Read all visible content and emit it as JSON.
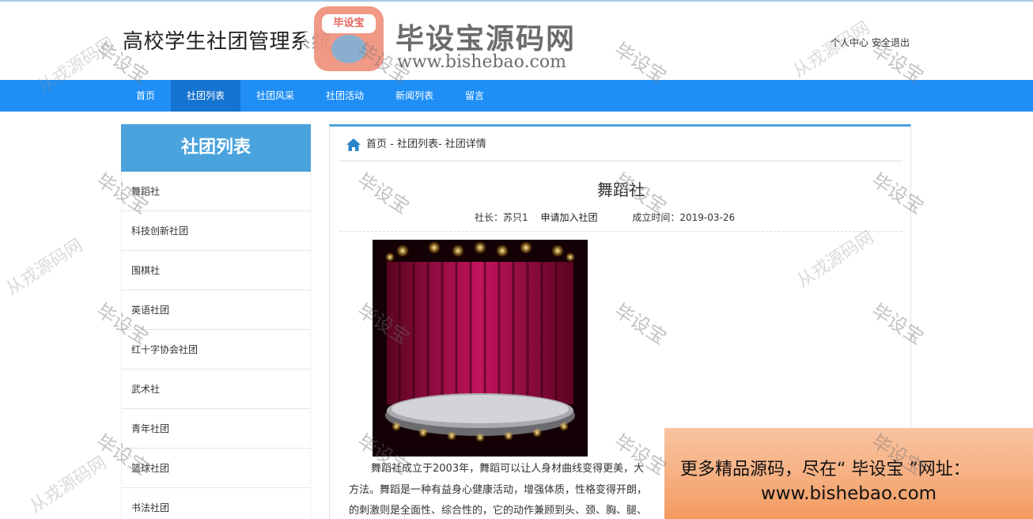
{
  "header": {
    "site_title": "高校学生社团管理系统",
    "links": [
      "个人中心",
      "安全退出"
    ]
  },
  "logo": {
    "badge_text": "毕设宝",
    "name": "毕设宝源码网",
    "url": "www.bishebao.com"
  },
  "nav": {
    "items": [
      "首页",
      "社团列表",
      "社团风采",
      "社团活动",
      "新闻列表",
      "留言"
    ],
    "active": "社团列表"
  },
  "sidebar": {
    "title": "社团列表",
    "items": [
      "舞蹈社",
      "科技创新社团",
      "围棋社",
      "英语社团",
      "红十字协会社团",
      "武术社",
      "青年社团",
      "篮球社团",
      "书法社团"
    ]
  },
  "main": {
    "breadcrumb": "首页 - 社团列表- 社团详情",
    "title": "舞蹈社",
    "meta": {
      "leader_label": "社长：",
      "leader": "苏只1",
      "join_label": "申请加入社团",
      "date_label": "成立时间：",
      "date": "2019-03-26"
    },
    "paragraphs": [
      "舞蹈社成立于2003年，舞蹈可以让人身材曲线变得更美，大",
      "方法。舞蹈是一种有益身心健康活动，增强体质，性格变得开朗，",
      "的刺激则是全面性、综合性的，它的动作兼顾到头、颈、胸、腿、"
    ]
  },
  "promo": {
    "line1": "更多精品源码，尽在“ 毕设宝 ”网址：",
    "line2": "www.bishebao.com"
  },
  "watermarks": {
    "primary": "毕设宝",
    "secondary": "从戎源码网"
  },
  "colors": {
    "nav": "#1f8ff6",
    "nav_active": "#1574cf",
    "sidebar_title": "#4aa3dd"
  }
}
